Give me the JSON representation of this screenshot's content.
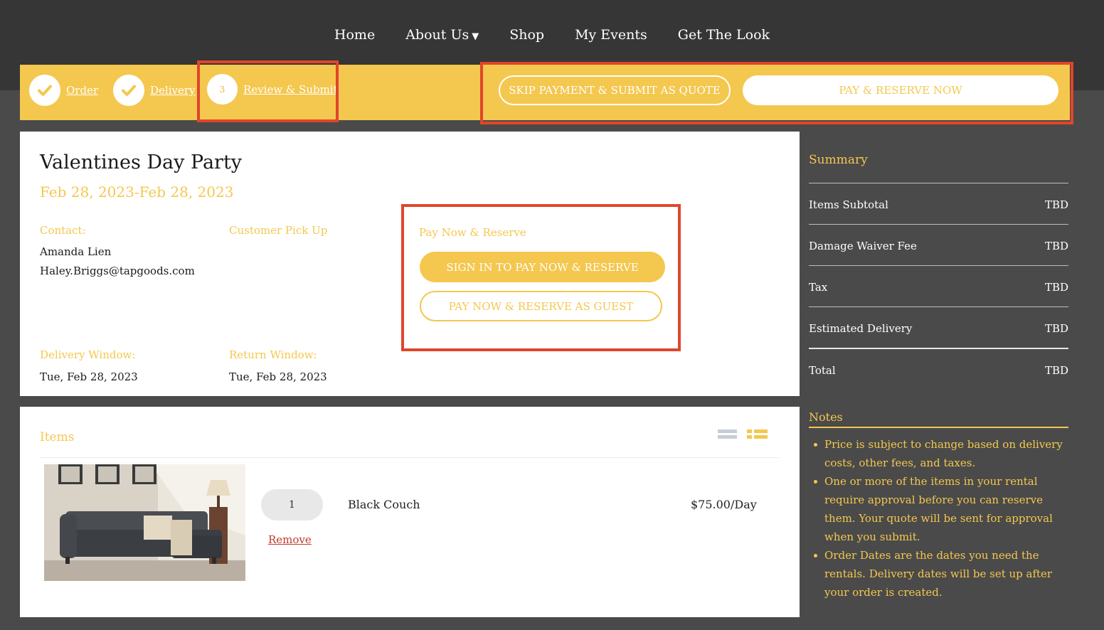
{
  "nav": {
    "items": [
      "Home",
      "About Us",
      "Shop",
      "My Events",
      "Get The Look"
    ]
  },
  "steps": [
    {
      "label": "Order",
      "state": "done"
    },
    {
      "label": "Delivery",
      "state": "done"
    },
    {
      "label": "Review & Submit",
      "number": "3",
      "state": "current"
    }
  ],
  "header_actions": {
    "skip_label": "SKIP PAYMENT & SUBMIT AS QUOTE",
    "pay_label": "PAY & RESERVE NOW"
  },
  "event": {
    "title": "Valentines Day Party",
    "dates": "Feb 28, 2023-Feb 28, 2023",
    "contact_label": "Contact:",
    "contact_name": "Amanda Lien",
    "contact_email": "Haley.Briggs@tapgoods.com",
    "pickup_label": "Customer Pick Up",
    "delivery_window_label": "Delivery Window:",
    "delivery_window_value": "Tue, Feb 28, 2023",
    "return_window_label": "Return Window:",
    "return_window_value": "Tue, Feb 28, 2023"
  },
  "pay_panel": {
    "title": "Pay Now & Reserve",
    "sign_in_label": "SIGN IN TO PAY NOW & RESERVE",
    "guest_label": "PAY NOW & RESERVE AS GUEST"
  },
  "items": {
    "title": "Items",
    "list": [
      {
        "quantity": "1",
        "remove_label": "Remove",
        "name": "Black Couch",
        "price": "$75.00/Day"
      }
    ]
  },
  "summary": {
    "title": "Summary",
    "rows": [
      {
        "label": "Items Subtotal",
        "value": "TBD"
      },
      {
        "label": "Damage Waiver Fee",
        "value": "TBD"
      },
      {
        "label": "Tax",
        "value": "TBD"
      },
      {
        "label": "Estimated Delivery",
        "value": "TBD"
      }
    ],
    "total": {
      "label": "Total",
      "value": "TBD"
    }
  },
  "notes": {
    "title": "Notes",
    "items": [
      "Price is subject to change based on delivery costs, other fees, and taxes.",
      "One or more of the items in your rental require approval before you can reserve them. Your quote will be sent for approval when you submit.",
      "Order Dates are the dates you need the rentals. Delivery dates will be set up after your order is created."
    ]
  },
  "colors": {
    "accent": "#f4c74e",
    "highlight": "#e0452c",
    "topbar": "#363636",
    "background": "#4a4a4a"
  }
}
